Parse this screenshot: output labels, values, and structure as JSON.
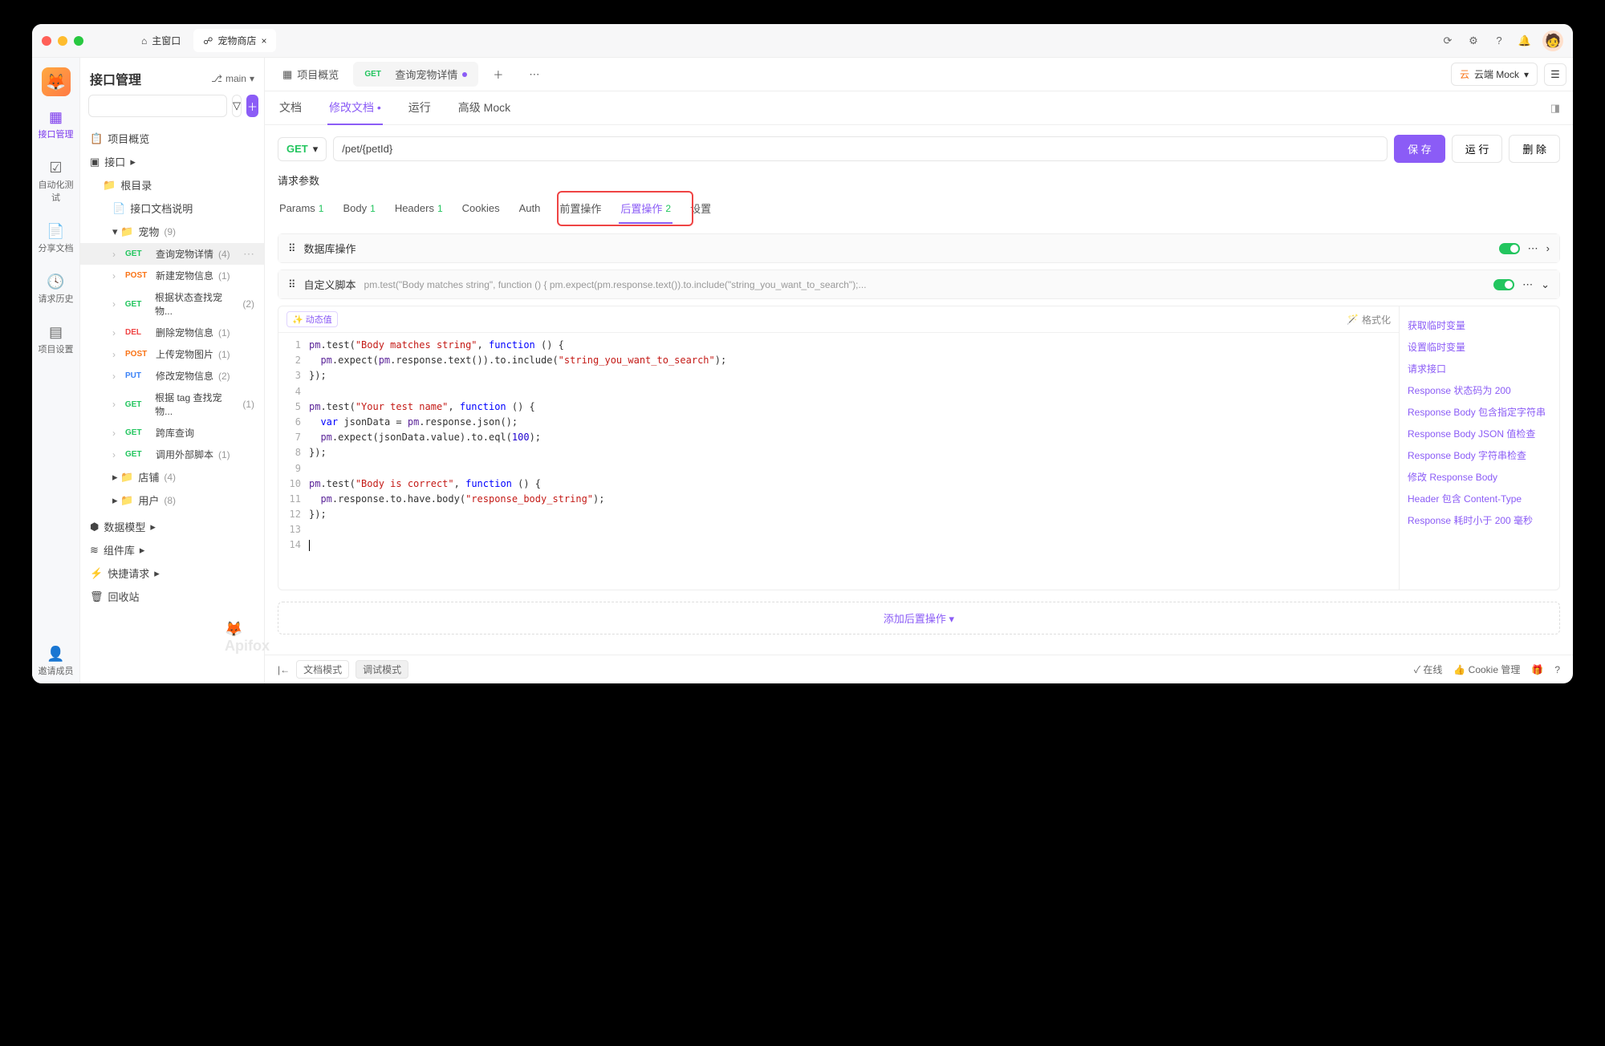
{
  "titlebar": {
    "tab_main": "主窗口",
    "tab_active": "宠物商店"
  },
  "rail": {
    "items": [
      {
        "label": "接口管理"
      },
      {
        "label": "自动化测试"
      },
      {
        "label": "分享文档"
      },
      {
        "label": "请求历史"
      },
      {
        "label": "项目设置"
      }
    ],
    "invite": "邀请成员"
  },
  "sidebar": {
    "title": "接口管理",
    "branch": "main",
    "search_placeholder": "",
    "nodes": {
      "overview": "项目概览",
      "api_root": "接口",
      "root_dir": "根目录",
      "doc_desc": "接口文档说明",
      "pets": "宠物",
      "pets_count": "(9)",
      "shop": "店铺",
      "shop_count": "(4)",
      "user": "用户",
      "user_count": "(8)",
      "data_model": "数据模型",
      "component_lib": "组件库",
      "quick_request": "快捷请求",
      "recycle": "回收站"
    },
    "pet_apis": [
      {
        "method": "GET",
        "mclass": "m-get",
        "name": "查询宠物详情",
        "count": "(4)",
        "active": true
      },
      {
        "method": "POST",
        "mclass": "m-post",
        "name": "新建宠物信息",
        "count": "(1)"
      },
      {
        "method": "GET",
        "mclass": "m-get",
        "name": "根据状态查找宠物...",
        "count": "(2)"
      },
      {
        "method": "DEL",
        "mclass": "m-del",
        "name": "删除宠物信息",
        "count": "(1)"
      },
      {
        "method": "POST",
        "mclass": "m-post",
        "name": "上传宠物图片",
        "count": "(1)"
      },
      {
        "method": "PUT",
        "mclass": "m-put",
        "name": "修改宠物信息",
        "count": "(2)"
      },
      {
        "method": "GET",
        "mclass": "m-get",
        "name": "根据 tag 查找宠物...",
        "count": "(1)"
      },
      {
        "method": "GET",
        "mclass": "m-get",
        "name": "跨库查询",
        "count": ""
      },
      {
        "method": "GET",
        "mclass": "m-get",
        "name": "调用外部脚本",
        "count": "(1)"
      }
    ]
  },
  "main_tabs": {
    "overview": "项目概览",
    "active_method": "GET",
    "active_name": "查询宠物详情",
    "mock": "云端 Mock"
  },
  "inner_tabs": [
    "文档",
    "修改文档",
    "运行",
    "高级 Mock"
  ],
  "path": {
    "method": "GET",
    "value": "/pet/{petId}",
    "save": "保 存",
    "run": "运 行",
    "delete": "删 除"
  },
  "req": {
    "title": "请求参数",
    "tabs": [
      {
        "label": "Params",
        "num": "1"
      },
      {
        "label": "Body",
        "num": "1"
      },
      {
        "label": "Headers",
        "num": "1"
      },
      {
        "label": "Cookies",
        "num": ""
      },
      {
        "label": "Auth",
        "num": ""
      },
      {
        "label": "前置操作",
        "num": ""
      },
      {
        "label": "后置操作",
        "num": "2"
      },
      {
        "label": "设置",
        "num": ""
      }
    ]
  },
  "panels": {
    "db": "数据库操作",
    "script": "自定义脚本",
    "script_preview": "pm.test(\"Body matches string\", function () { pm.expect(pm.response.text()).to.include(\"string_you_want_to_search\");..."
  },
  "editor": {
    "dynamic": "动态值",
    "format": "格式化",
    "lines_rendered": 14
  },
  "snippets": [
    "获取临时变量",
    "设置临时变量",
    "请求接口",
    "Response 状态码为 200",
    "Response Body 包含指定字符串",
    "Response Body JSON 值检查",
    "Response Body 字符串检查",
    "修改 Response Body",
    "Header 包含 Content-Type",
    "Response 耗时小于 200 毫秒"
  ],
  "add_op": "添加后置操作",
  "footer": {
    "mode_doc": "文档模式",
    "mode_debug": "调试模式",
    "online": "在线",
    "cookie": "Cookie 管理"
  },
  "watermark": "Apifox"
}
